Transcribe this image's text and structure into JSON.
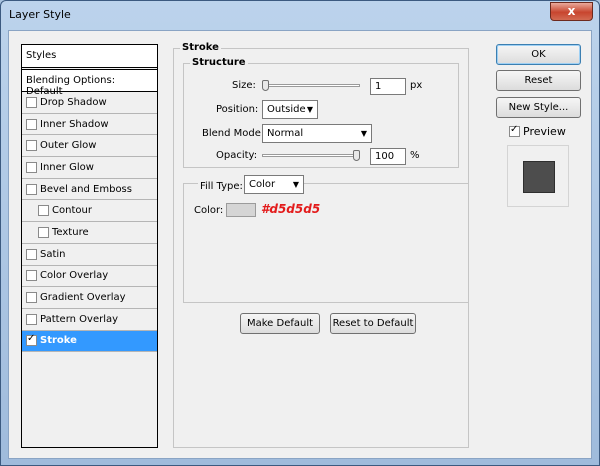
{
  "window": {
    "title": "Layer Style",
    "close_glyph": "x"
  },
  "styles_list": {
    "header": "Styles",
    "blending": "Blending Options: Default",
    "items": [
      {
        "label": "Drop Shadow",
        "checked": false,
        "sub": false,
        "selected": false
      },
      {
        "label": "Inner Shadow",
        "checked": false,
        "sub": false,
        "selected": false
      },
      {
        "label": "Outer Glow",
        "checked": false,
        "sub": false,
        "selected": false
      },
      {
        "label": "Inner Glow",
        "checked": false,
        "sub": false,
        "selected": false
      },
      {
        "label": "Bevel and Emboss",
        "checked": false,
        "sub": false,
        "selected": false
      },
      {
        "label": "Contour",
        "checked": false,
        "sub": true,
        "selected": false
      },
      {
        "label": "Texture",
        "checked": false,
        "sub": true,
        "selected": false
      },
      {
        "label": "Satin",
        "checked": false,
        "sub": false,
        "selected": false
      },
      {
        "label": "Color Overlay",
        "checked": false,
        "sub": false,
        "selected": false
      },
      {
        "label": "Gradient Overlay",
        "checked": false,
        "sub": false,
        "selected": false
      },
      {
        "label": "Pattern Overlay",
        "checked": false,
        "sub": false,
        "selected": false
      },
      {
        "label": "Stroke",
        "checked": true,
        "sub": false,
        "selected": true
      }
    ]
  },
  "stroke": {
    "title": "Stroke",
    "structure": {
      "title": "Structure",
      "size_label": "Size:",
      "size_value": "1",
      "size_unit": "px",
      "size_fraction": 0.0,
      "position_label": "Position:",
      "position_value": "Outside",
      "blend_label": "Blend Mode:",
      "blend_value": "Normal",
      "opacity_label": "Opacity:",
      "opacity_value": "100",
      "opacity_unit": "%",
      "opacity_fraction": 1.0
    },
    "fill": {
      "type_label": "Fill Type:",
      "type_value": "Color",
      "color_label": "Color:",
      "color_hex": "#d5d5d5",
      "color_annotation": "#d5d5d5"
    },
    "make_default": "Make Default",
    "reset_default": "Reset to Default"
  },
  "buttons": {
    "ok": "OK",
    "reset": "Reset",
    "new_style": "New Style..."
  },
  "preview": {
    "label": "Preview",
    "checked": true
  }
}
